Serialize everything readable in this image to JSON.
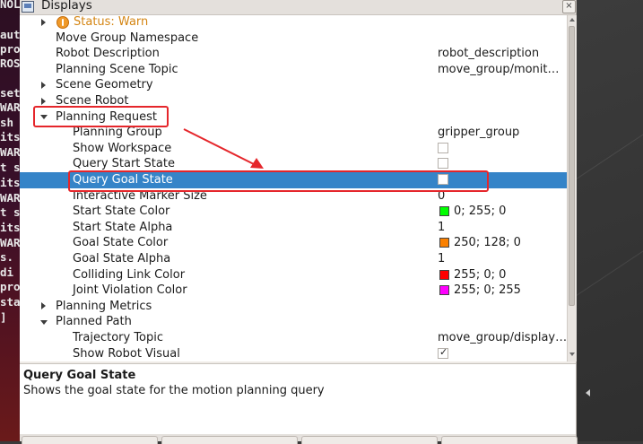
{
  "terminal": {
    "lines": [
      "NOL",
      "",
      "aut",
      "pro",
      "ROS",
      "",
      "set",
      "WAR",
      " sh",
      "its,",
      "WAR",
      "t s",
      "its",
      "WAR",
      "t s",
      "its",
      "WAR",
      "s.",
      " di",
      "pro",
      "sta",
      "]"
    ]
  },
  "window": {
    "title": "Displays",
    "close_label": "×"
  },
  "tree": {
    "status": {
      "label": "Status: Warn"
    },
    "rows": [
      {
        "name": "Move Group Namespace",
        "value": ""
      },
      {
        "name": "Robot Description",
        "value": "robot_description"
      },
      {
        "name": "Planning Scene Topic",
        "value": "move_group/monit…"
      },
      {
        "name": "Scene Geometry",
        "value": ""
      },
      {
        "name": "Scene Robot",
        "value": ""
      },
      {
        "name": "Planning Request",
        "value": ""
      },
      {
        "name": "Planning Group",
        "value": "gripper_group"
      },
      {
        "name": "Show Workspace",
        "value": ""
      },
      {
        "name": "Query Start State",
        "value": ""
      },
      {
        "name": "Query Goal State",
        "value": ""
      },
      {
        "name": "Interactive Marker Size",
        "value": "0"
      },
      {
        "name": "Start State Color",
        "value": "0; 255; 0"
      },
      {
        "name": "Start State Alpha",
        "value": "1"
      },
      {
        "name": "Goal State Color",
        "value": "250; 128; 0"
      },
      {
        "name": "Goal State Alpha",
        "value": "1"
      },
      {
        "name": "Colliding Link Color",
        "value": "255; 0; 0"
      },
      {
        "name": "Joint Violation Color",
        "value": "255; 0; 255"
      },
      {
        "name": "Planning Metrics",
        "value": ""
      },
      {
        "name": "Planned Path",
        "value": ""
      },
      {
        "name": "Trajectory Topic",
        "value": "move_group/display…"
      },
      {
        "name": "Show Robot Visual",
        "value": ""
      }
    ],
    "checkboxes": {
      "show_workspace": false,
      "query_start_state": false,
      "query_goal_state": false,
      "show_robot_visual": true
    },
    "colors": {
      "start_state": "#00ff00",
      "goal_state": "#fa8000",
      "colliding_link": "#ff0000",
      "joint_violation": "#ff00ff",
      "status_warn": "#f09a2a",
      "selection": "#3584c8",
      "annotation": "#e5262b"
    }
  },
  "description": {
    "title": "Query Goal State",
    "text": "Shows the goal state for the motion planning query"
  },
  "icons": {
    "displays": "displays-icon",
    "warn": "warning-icon",
    "close": "close-icon"
  }
}
